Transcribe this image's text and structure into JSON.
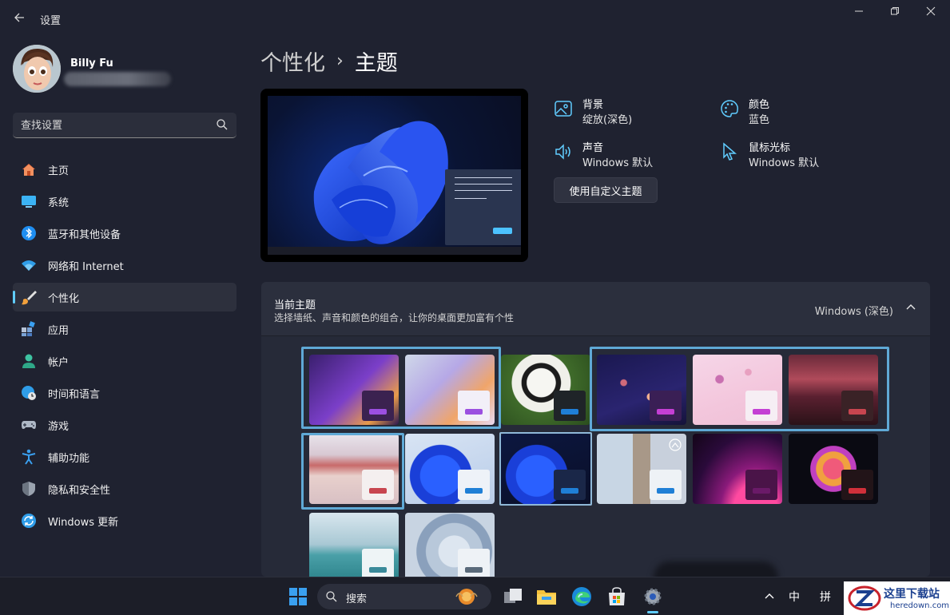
{
  "window": {
    "app_title": "设置",
    "back_icon": "arrow-left-icon",
    "controls": [
      "minimize-icon",
      "restore-icon",
      "close-icon"
    ]
  },
  "user": {
    "name": "Billy Fu"
  },
  "search": {
    "placeholder": "查找设置"
  },
  "sidebar": {
    "items": [
      {
        "label": "主页",
        "icon": "home-icon"
      },
      {
        "label": "系统",
        "icon": "monitor-icon"
      },
      {
        "label": "蓝牙和其他设备",
        "icon": "bluetooth-icon"
      },
      {
        "label": "网络和 Internet",
        "icon": "wifi-icon"
      },
      {
        "label": "个性化",
        "icon": "brush-icon",
        "active": true
      },
      {
        "label": "应用",
        "icon": "apps-icon"
      },
      {
        "label": "帐户",
        "icon": "person-icon"
      },
      {
        "label": "时间和语言",
        "icon": "globe-clock-icon"
      },
      {
        "label": "游戏",
        "icon": "gamepad-icon"
      },
      {
        "label": "辅助功能",
        "icon": "accessibility-icon"
      },
      {
        "label": "隐私和安全性",
        "icon": "shield-icon"
      },
      {
        "label": "Windows 更新",
        "icon": "refresh-icon"
      }
    ]
  },
  "breadcrumb": {
    "parent": "个性化",
    "separator": "›",
    "current": "主题"
  },
  "properties": {
    "background": {
      "label": "背景",
      "value": "绽放(深色)"
    },
    "color": {
      "label": "颜色",
      "value": "蓝色"
    },
    "sound": {
      "label": "声音",
      "value": "Windows 默认"
    },
    "cursor": {
      "label": "鼠标光标",
      "value": "Windows 默认"
    }
  },
  "custom_theme_button": "使用自定义主题",
  "themes": {
    "title": "当前主题",
    "description": "选择墙纸、声音和颜色的组合，让你的桌面更加富有个性",
    "current": "Windows (深色)"
  },
  "taskbar": {
    "search_label": "搜索",
    "tray": {
      "input_mode": "中",
      "ime": "拼"
    }
  },
  "watermark": {
    "title": "这里下载站",
    "url": "heredown.com"
  },
  "colors": {
    "accent": "#60cdff",
    "selection": "#5fa9d6"
  }
}
